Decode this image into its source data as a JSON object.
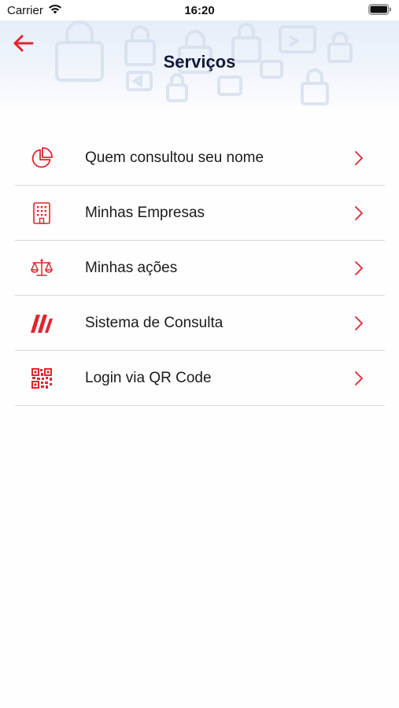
{
  "status_bar": {
    "carrier": "Carrier",
    "time": "16:20",
    "wifi_icon": "wifi-icon",
    "battery_icon": "battery-icon"
  },
  "header": {
    "title": "Serviços",
    "back_icon": "arrow-left-icon"
  },
  "colors": {
    "accent": "#e1252f",
    "title": "#121a38",
    "text": "#1b1b1f",
    "divider": "#d9d9dc"
  },
  "menu": {
    "items": [
      {
        "label": "Quem consultou seu nome",
        "icon": "pie-chart-icon"
      },
      {
        "label": "Minhas Empresas",
        "icon": "building-icon"
      },
      {
        "label": "Minhas ações",
        "icon": "scales-icon"
      },
      {
        "label": "Sistema de Consulta",
        "icon": "brand-slashes-icon"
      },
      {
        "label": "Login via QR Code",
        "icon": "qr-code-icon"
      }
    ]
  }
}
